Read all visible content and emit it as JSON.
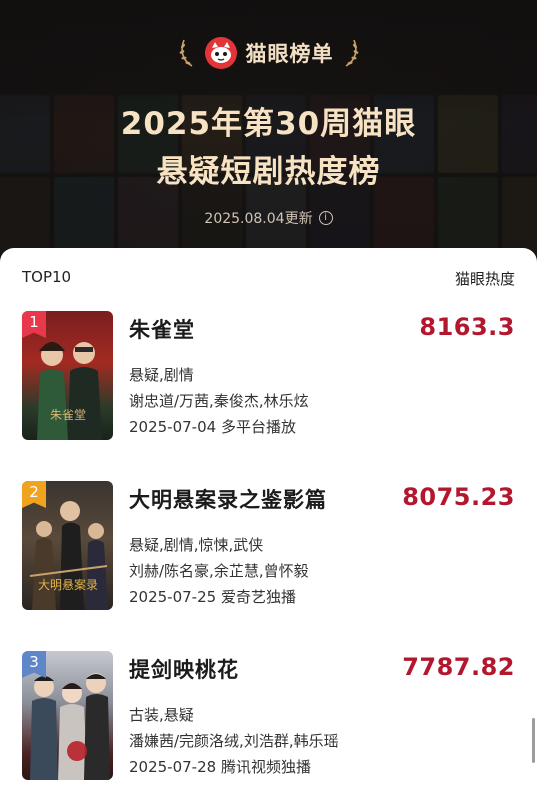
{
  "header": {
    "brand": "猫眼榜单",
    "title_line1": "2025年第30周猫眼",
    "title_line2": "悬疑短剧热度榜",
    "updated": "2025.08.04更新"
  },
  "list": {
    "label_left": "TOP10",
    "label_right": "猫眼热度",
    "items": [
      {
        "rank": "1",
        "title": "朱雀堂",
        "score": "8163.3",
        "genres": "悬疑,剧情",
        "cast": "谢忠道/万茜,秦俊杰,林乐炫",
        "release": "2025-07-04 多平台播放",
        "rank_color": "#e8384b"
      },
      {
        "rank": "2",
        "title": "大明悬案录之鉴影篇",
        "score": "8075.23",
        "genres": "悬疑,剧情,惊悚,武侠",
        "cast": "刘赫/陈名豪,余芷慧,曾怀毅",
        "release": "2025-07-25 爱奇艺独播",
        "rank_color": "#f0a31f"
      },
      {
        "rank": "3",
        "title": "提剑映桃花",
        "score": "7787.82",
        "genres": "古装,悬疑",
        "cast": "潘嫌茜/完颜洛绒,刘浩群,韩乐瑶",
        "release": "2025-07-28 腾讯视频独播",
        "rank_color": "#5f86c9"
      }
    ]
  },
  "colors": {
    "accent": "#b3172e",
    "title_gold": "#f7e3c3"
  }
}
